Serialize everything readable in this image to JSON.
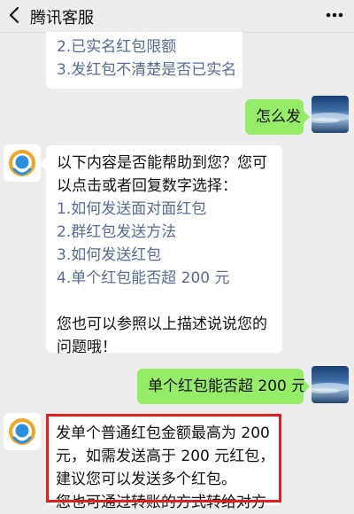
{
  "header": {
    "title": "腾讯客服"
  },
  "messages": {
    "partial_bot": {
      "lines": [
        "2.已实名红包限额",
        "3.发红包不清楚是否已实名"
      ]
    },
    "user1": {
      "text": "怎么发"
    },
    "bot1": {
      "intro_1": "以下内容是否能帮助到您？您可",
      "intro_2": "以点击或者回复数字选择：",
      "options": [
        "1.如何发送面对面红包",
        "2.群红包发送方法",
        "3.如何发送红包",
        "4.单个红包能否超 200 元"
      ],
      "outro_1": "您也可以参照以上描述说说您的",
      "outro_2": "问题哦！"
    },
    "user2": {
      "text": "单个红包能否超 200 元"
    },
    "bot2": {
      "lines": [
        "发单个普通红包金额最高为 200",
        "元，如需发送高于 200 元红包，",
        "建议您可以发送多个红包。",
        "您也可通过转账的方式转给对方"
      ]
    }
  },
  "colors": {
    "outgoing_bubble": "#95ec69",
    "incoming_bubble": "#ffffff",
    "link_option": "#576b95",
    "highlight_border": "#e02020"
  }
}
